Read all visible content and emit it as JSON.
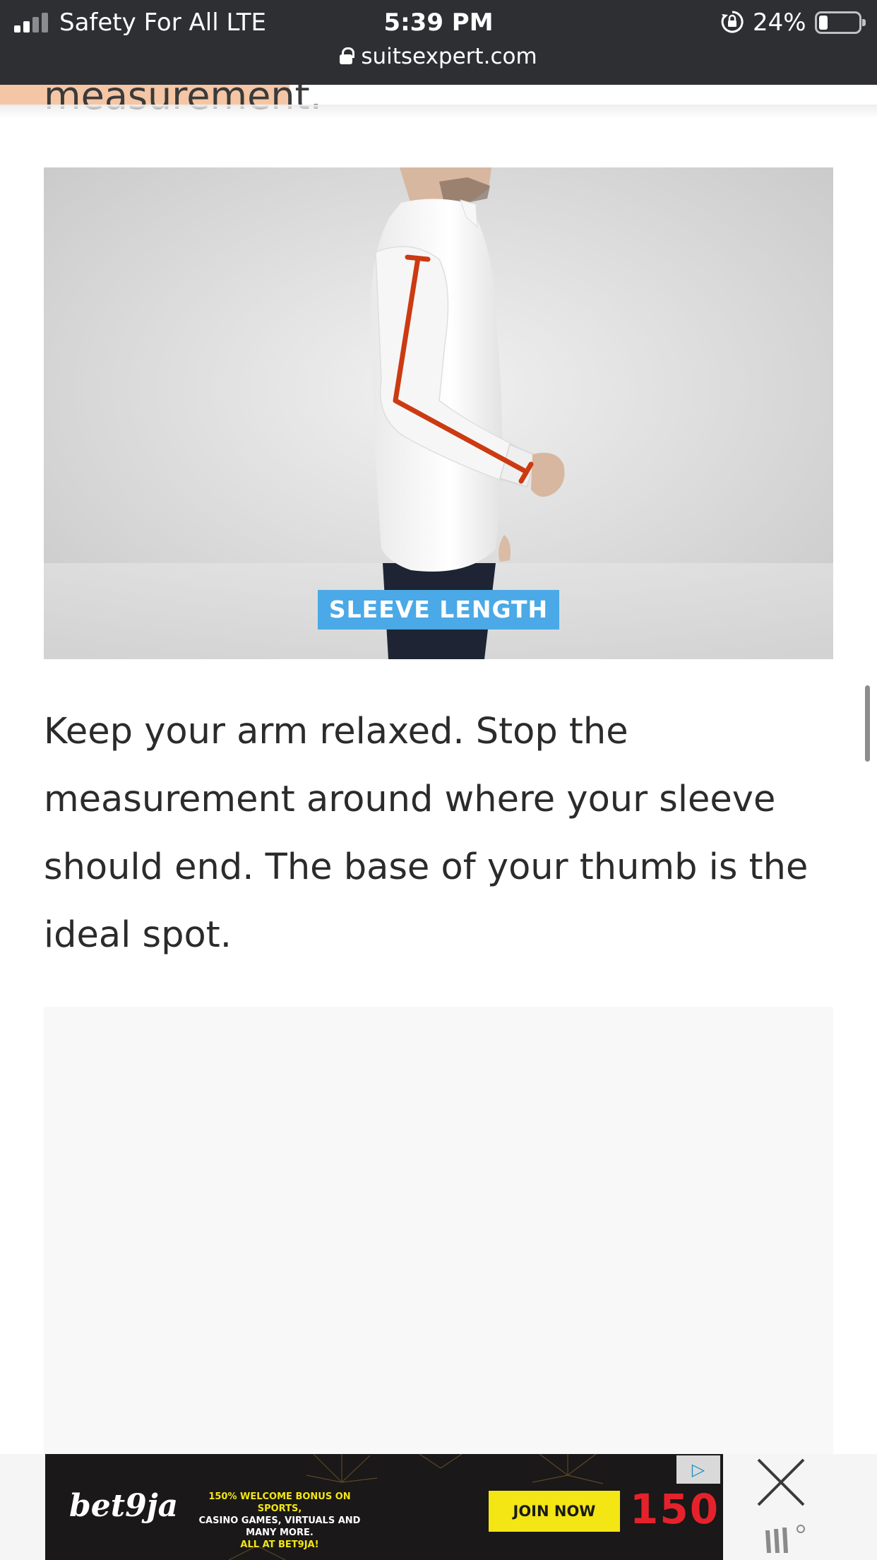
{
  "status_bar": {
    "carrier": "Safety For All  LTE",
    "time": "5:39 PM",
    "battery_percent": "24%",
    "battery_level": 0.24,
    "signal_bars_active": 2,
    "signal_bars_total": 4
  },
  "browser": {
    "url": "suitsexpert.com"
  },
  "article": {
    "previous_text_fragment": "measurement.",
    "figure_caption": "SLEEVE LENGTH",
    "paragraph": "Keep your arm relaxed. Stop the measurement around where your sleeve should end. The base of your thumb is the ideal spot."
  },
  "ad_banner": {
    "brand": "bet9ja",
    "promo_line_1": "150% WELCOME BONUS ON SPORTS,",
    "promo_line_2": "CASINO GAMES, VIRTUALS AND MANY MORE.",
    "promo_line_3": "ALL AT BET9JA!",
    "cta": "JOIN NOW",
    "bonus": "150!"
  },
  "colors": {
    "status_bar_bg": "#2d2f33",
    "measure_line": "#cc3a12",
    "caption_bg": "#4aa9e6",
    "cta_bg": "#f3e614",
    "bonus_red": "#e5222b",
    "progress": "#f5c6a5"
  },
  "icons": {
    "signal": "cellular-signal-icon",
    "orientation_lock": "orientation-lock-icon",
    "battery": "battery-icon",
    "padlock": "padlock-icon",
    "ad_choices": "ad-choices-icon",
    "close": "close-icon",
    "ad_network_logo": "ad-network-logo-icon"
  }
}
